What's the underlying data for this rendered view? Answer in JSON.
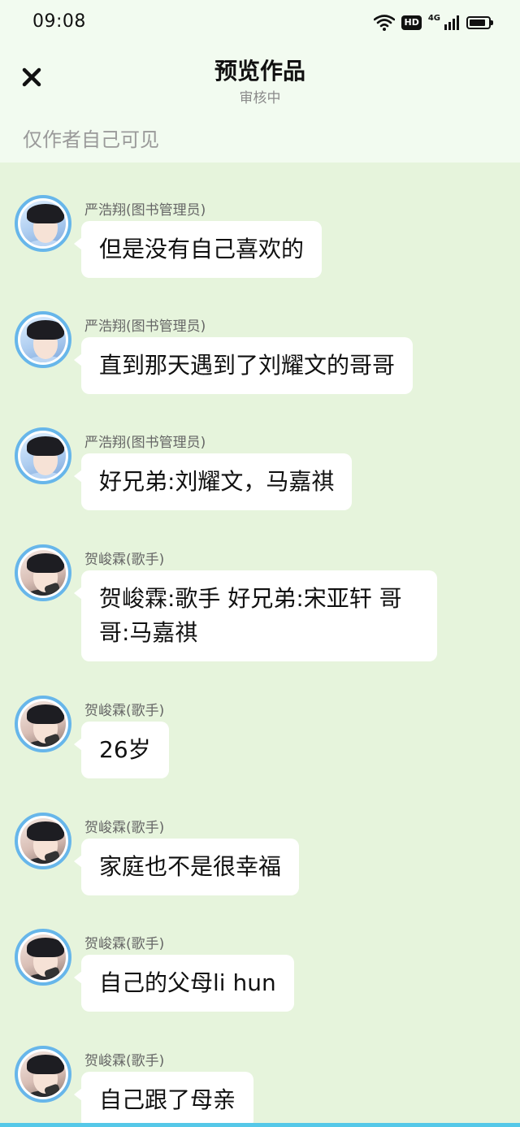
{
  "status_bar": {
    "time": "09:08",
    "wifi_icon": "wifi-icon",
    "hd_label": "HD",
    "network_label": "4G",
    "battery_level": 0.85
  },
  "header": {
    "close_icon": "close-icon",
    "title": "预览作品",
    "subtitle": "审核中",
    "visibility_note": "仅作者自己可见"
  },
  "messages": [
    {
      "name": "严浩翔(图书管理员)",
      "text": "但是没有自己喜欢的",
      "avatar": "avatar-a"
    },
    {
      "name": "严浩翔(图书管理员)",
      "text": "直到那天遇到了刘耀文的哥哥",
      "avatar": "avatar-a"
    },
    {
      "name": "严浩翔(图书管理员)",
      "text": "好兄弟:刘耀文，马嘉祺",
      "avatar": "avatar-a"
    },
    {
      "name": "贺峻霖(歌手)",
      "text": "贺峻霖:歌手 好兄弟:宋亚轩 哥哥:马嘉祺",
      "avatar": "avatar-b"
    },
    {
      "name": "贺峻霖(歌手)",
      "text": "26岁",
      "avatar": "avatar-b"
    },
    {
      "name": "贺峻霖(歌手)",
      "text": "家庭也不是很幸福",
      "avatar": "avatar-b"
    },
    {
      "name": "贺峻霖(歌手)",
      "text": "自己的父母li hun",
      "avatar": "avatar-b"
    },
    {
      "name": "贺峻霖(歌手)",
      "text": "自己跟了母亲",
      "avatar": "avatar-b"
    }
  ],
  "colors": {
    "background": "#e6f4dc",
    "header": "#f2fbf0",
    "bubble": "#ffffff",
    "avatar_ring": "#67b6ea",
    "accent_bar": "#55c8e8"
  }
}
